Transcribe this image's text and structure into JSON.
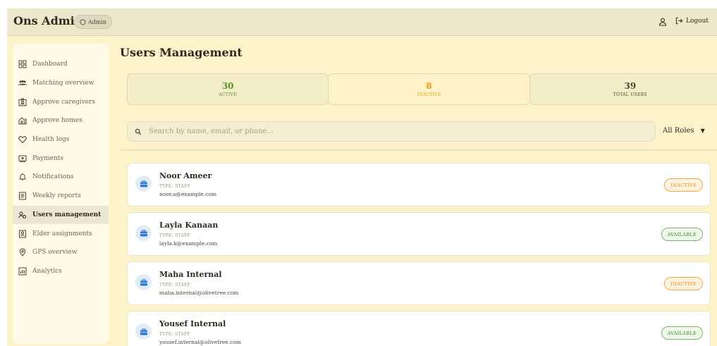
{
  "header": {
    "brand": "Ons Admin",
    "role_badge": "Admin",
    "logout_label": "Logout"
  },
  "sidebar": {
    "items": [
      {
        "label": "Dashboard",
        "icon": "dashboard-icon"
      },
      {
        "label": "Matching overview",
        "icon": "people-icon"
      },
      {
        "label": "Approve caregivers",
        "icon": "id-card-icon"
      },
      {
        "label": "Approve homes",
        "icon": "home-icon"
      },
      {
        "label": "Health logs",
        "icon": "heart-icon"
      },
      {
        "label": "Payments",
        "icon": "payment-icon"
      },
      {
        "label": "Notifications",
        "icon": "bell-icon"
      },
      {
        "label": "Weekly reports",
        "icon": "report-icon"
      },
      {
        "label": "Users management",
        "icon": "users-icon",
        "active": true
      },
      {
        "label": "Elder assignments",
        "icon": "assignment-icon"
      },
      {
        "label": "GPS overview",
        "icon": "location-icon"
      },
      {
        "label": "Analytics",
        "icon": "analytics-icon"
      }
    ]
  },
  "main": {
    "title": "Users Management",
    "stats": [
      {
        "value": "30",
        "label": "ACTIVE",
        "color": "#5a8f2e"
      },
      {
        "value": "8",
        "label": "INACTIVE",
        "color": "#e89a1a"
      },
      {
        "value": "39",
        "label": "TOTAL USERS",
        "color": "#4a4535"
      }
    ],
    "search": {
      "placeholder": "Search by name, email, or phone...",
      "value": ""
    },
    "role_filter": {
      "selected": "All Roles"
    },
    "users": [
      {
        "name": "Noor Ameer",
        "type": "TYPE: STAFF",
        "email": "noor.a@example.com",
        "status": "INACTIVE"
      },
      {
        "name": "Layla Kanaan",
        "type": "TYPE: STAFF",
        "email": "layla.k@example.com",
        "status": "AVAILABLE"
      },
      {
        "name": "Maha Internal",
        "type": "TYPE: STAFF",
        "email": "maha.internal@olivetree.com",
        "status": "INACTIVE"
      },
      {
        "name": "Yousef Internal",
        "type": "TYPE: STAFF",
        "email": "yousef.internal@olivetree.com",
        "status": "AVAILABLE"
      }
    ]
  },
  "colors": {
    "background": "#fdf3cb",
    "topbar": "#ece8cc",
    "inactive": "#e08a10",
    "available": "#3c8a2a"
  }
}
